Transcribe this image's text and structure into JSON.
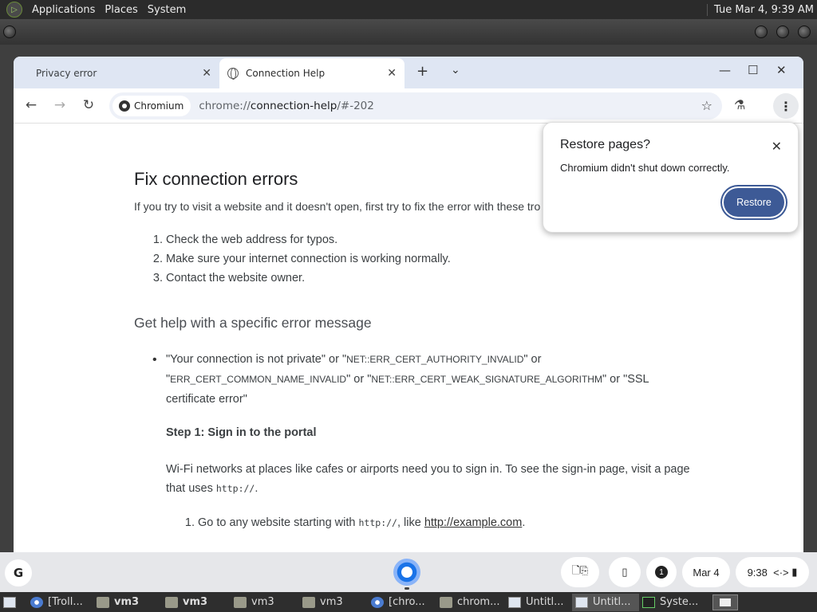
{
  "top_panel": {
    "menus": [
      "Applications",
      "Places",
      "System"
    ],
    "clock": "Tue Mar  4,  9:39 AM"
  },
  "browser": {
    "tabs": [
      {
        "title": "Privacy error",
        "active": false
      },
      {
        "title": "Connection Help",
        "active": true
      }
    ],
    "omnibox": {
      "chip_label": "Chromium",
      "url_scheme": "chrome://",
      "url_host": "connection-help",
      "url_rest": "/#-202"
    }
  },
  "page": {
    "heading": "Fix connection errors",
    "intro": "If you try to visit a website and it doesn't open, first try to fix the error with these tro",
    "steps": [
      "Check the web address for typos.",
      "Make sure your internet connection is working normally.",
      "Contact the website owner."
    ],
    "subheading": "Get help with a specific error message",
    "bullet": {
      "q1": "\"Your connection is not private\" or \"",
      "c1": "NET::ERR_CERT_AUTHORITY_INVALID",
      "q2": "\" or",
      "q3": "\"",
      "c2": "ERR_CERT_COMMON_NAME_INVALID",
      "q4": "\" or \"",
      "c3": "NET::ERR_CERT_WEAK_SIGNATURE_ALGORITHM",
      "q5": "\" or \"SSL certificate error\""
    },
    "step1_title": "Step 1: Sign in to the portal",
    "wifi_text": "Wi-Fi networks at places like cafes or airports need you to sign in. To see the sign-in page, visit a page that uses ",
    "wifi_code": "http://",
    "wifi_end": ".",
    "sub_step_prefix": "Go to any website starting with ",
    "sub_step_code": "http://",
    "sub_step_mid": ", like ",
    "sub_step_link": "http://example.com",
    "sub_step_end": "."
  },
  "restore_popup": {
    "title": "Restore pages?",
    "message": "Chromium didn't shut down correctly.",
    "button": "Restore"
  },
  "shelf": {
    "launcher": "G",
    "notification_count": "1",
    "date": "Mar 4",
    "time": "9:38"
  },
  "taskbar": {
    "items": [
      {
        "label": "[Troll...",
        "icon": "globe-icon"
      },
      {
        "label": "vm3",
        "icon": "folder-icon"
      },
      {
        "label": "vm3",
        "icon": "folder-icon"
      },
      {
        "label": "vm3",
        "icon": "folder-icon"
      },
      {
        "label": "vm3",
        "icon": "folder-icon"
      },
      {
        "label": "[chro...",
        "icon": "globe-icon"
      },
      {
        "label": "chrom...",
        "icon": "folder-icon"
      },
      {
        "label": "Untitl...",
        "icon": "window-icon"
      },
      {
        "label": "Untitl...",
        "icon": "window-icon"
      },
      {
        "label": "Syste...",
        "icon": "terminal-icon"
      }
    ]
  }
}
